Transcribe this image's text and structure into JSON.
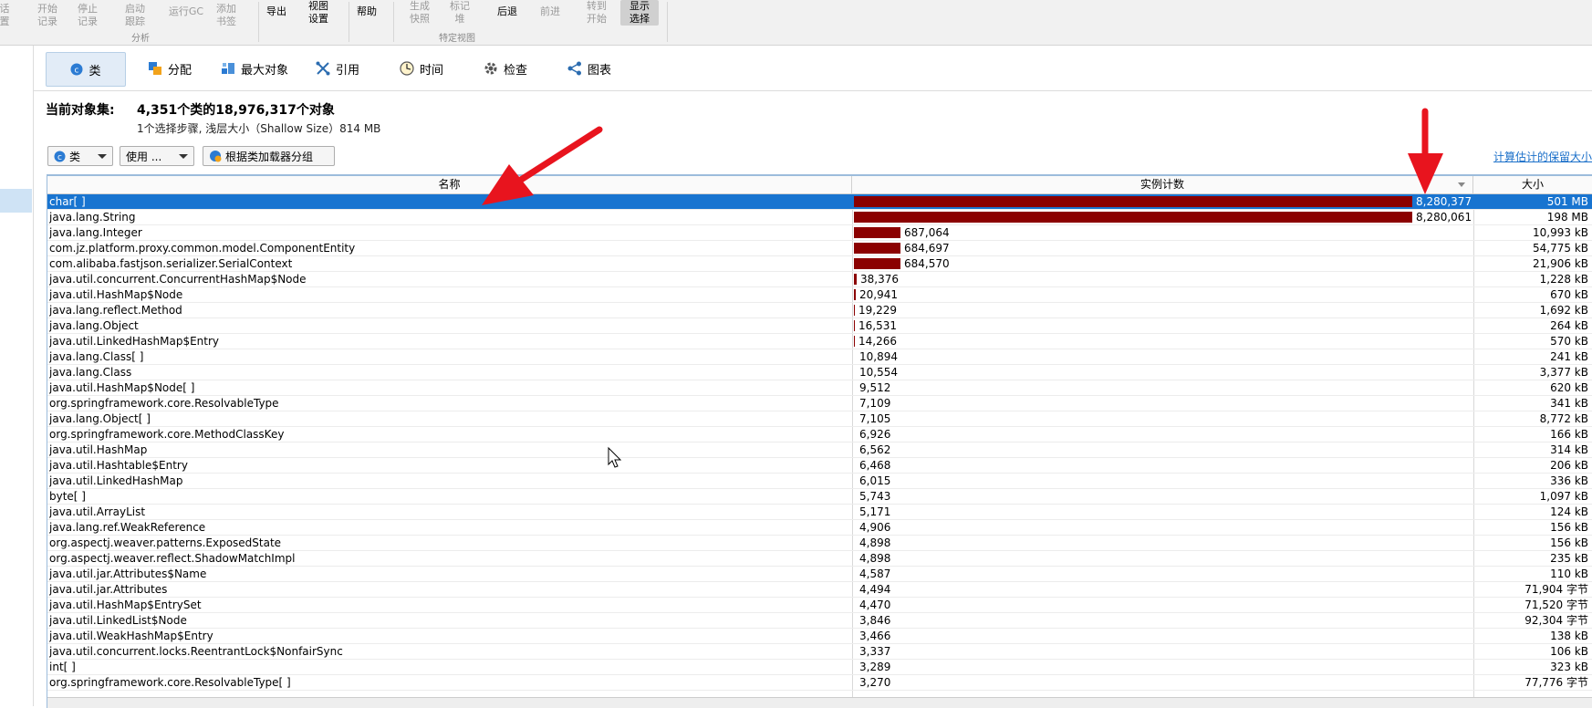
{
  "ribbon": {
    "buttons": [
      {
        "id": "settings",
        "label": "话\n置",
        "state": "dis"
      },
      {
        "id": "start-record",
        "label": "开始\n记录",
        "state": "dis"
      },
      {
        "id": "stop-record",
        "label": "停止\n记录",
        "state": "dis"
      },
      {
        "id": "start-trace",
        "label": "启动\n跟踪",
        "state": "dis"
      },
      {
        "id": "run-gc",
        "label": "运行GC",
        "state": "dis"
      },
      {
        "id": "add-bookmark",
        "label": "添加\n书签",
        "state": "dis"
      },
      {
        "id": "export",
        "label": "导出",
        "state": "en"
      },
      {
        "id": "view-settings",
        "label": "视图\n设置",
        "state": "en"
      },
      {
        "id": "help",
        "label": "帮助",
        "state": "en"
      },
      {
        "id": "gen-snapshot",
        "label": "生成\n快照",
        "state": "dis"
      },
      {
        "id": "mark-heap",
        "label": "标记\n堆",
        "state": "dis"
      },
      {
        "id": "back",
        "label": "后退",
        "state": "en"
      },
      {
        "id": "forward",
        "label": "前进",
        "state": "dis"
      },
      {
        "id": "goto-start",
        "label": "转到\n开始",
        "state": "dis"
      },
      {
        "id": "show-selection",
        "label": "显示\n选择",
        "state": "active"
      }
    ],
    "groups": {
      "analysis": "分析",
      "specific_view": "特定视图"
    }
  },
  "tabs": [
    {
      "label": "类",
      "icon": "class-icon",
      "selected": true
    },
    {
      "label": "分配",
      "icon": "allocation-icon",
      "selected": false
    },
    {
      "label": "最大对象",
      "icon": "biggest-objects-icon",
      "selected": false
    },
    {
      "label": "引用",
      "icon": "references-icon",
      "selected": false
    },
    {
      "label": "时间",
      "icon": "time-icon",
      "selected": false
    },
    {
      "label": "检查",
      "icon": "inspect-icon",
      "selected": false
    },
    {
      "label": "图表",
      "icon": "graph-icon",
      "selected": false
    }
  ],
  "summary": {
    "label": "当前对象集:",
    "value": "4,351个类的18,976,317个对象",
    "sub": "1个选择步骤, 浅层大小（Shallow Size）814 MB"
  },
  "filters": {
    "class_select": "类",
    "usage_select": "使用 ...",
    "group_by_loader": "根据类加载器分组",
    "calc_retained": "计算估计的保留大小"
  },
  "table": {
    "headers": {
      "name": "名称",
      "count": "实例计数",
      "size": "大小"
    },
    "max_count": 8280377,
    "rows": [
      {
        "name": "char[ ]",
        "count": 8280377,
        "count_text": "8,280,377",
        "size": "501 MB",
        "selected": true
      },
      {
        "name": "java.lang.String",
        "count": 8280061,
        "count_text": "8,280,061",
        "size": "198 MB"
      },
      {
        "name": "java.lang.Integer",
        "count": 687064,
        "count_text": "687,064",
        "size": "10,993 kB"
      },
      {
        "name": "com.jz.platform.proxy.common.model.ComponentEntity",
        "count": 684697,
        "count_text": "684,697",
        "size": "54,775 kB"
      },
      {
        "name": "com.alibaba.fastjson.serializer.SerialContext",
        "count": 684570,
        "count_text": "684,570",
        "size": "21,906 kB"
      },
      {
        "name": "java.util.concurrent.ConcurrentHashMap$Node",
        "count": 38376,
        "count_text": "38,376",
        "size": "1,228 kB"
      },
      {
        "name": "java.util.HashMap$Node",
        "count": 20941,
        "count_text": "20,941",
        "size": "670 kB"
      },
      {
        "name": "java.lang.reflect.Method",
        "count": 19229,
        "count_text": "19,229",
        "size": "1,692 kB"
      },
      {
        "name": "java.lang.Object",
        "count": 16531,
        "count_text": "16,531",
        "size": "264 kB"
      },
      {
        "name": "java.util.LinkedHashMap$Entry",
        "count": 14266,
        "count_text": "14,266",
        "size": "570 kB"
      },
      {
        "name": "java.lang.Class[ ]",
        "count": 10894,
        "count_text": "10,894",
        "size": "241 kB"
      },
      {
        "name": "java.lang.Class",
        "count": 10554,
        "count_text": "10,554",
        "size": "3,377 kB"
      },
      {
        "name": "java.util.HashMap$Node[ ]",
        "count": 9512,
        "count_text": "9,512",
        "size": "620 kB"
      },
      {
        "name": "org.springframework.core.ResolvableType",
        "count": 7109,
        "count_text": "7,109",
        "size": "341 kB"
      },
      {
        "name": "java.lang.Object[ ]",
        "count": 7105,
        "count_text": "7,105",
        "size": "8,772 kB"
      },
      {
        "name": "org.springframework.core.MethodClassKey",
        "count": 6926,
        "count_text": "6,926",
        "size": "166 kB"
      },
      {
        "name": "java.util.HashMap",
        "count": 6562,
        "count_text": "6,562",
        "size": "314 kB"
      },
      {
        "name": "java.util.Hashtable$Entry",
        "count": 6468,
        "count_text": "6,468",
        "size": "206 kB"
      },
      {
        "name": "java.util.LinkedHashMap",
        "count": 6015,
        "count_text": "6,015",
        "size": "336 kB"
      },
      {
        "name": "byte[ ]",
        "count": 5743,
        "count_text": "5,743",
        "size": "1,097 kB"
      },
      {
        "name": "java.util.ArrayList",
        "count": 5171,
        "count_text": "5,171",
        "size": "124 kB"
      },
      {
        "name": "java.lang.ref.WeakReference",
        "count": 4906,
        "count_text": "4,906",
        "size": "156 kB"
      },
      {
        "name": "org.aspectj.weaver.patterns.ExposedState",
        "count": 4898,
        "count_text": "4,898",
        "size": "156 kB"
      },
      {
        "name": "org.aspectj.weaver.reflect.ShadowMatchImpl",
        "count": 4898,
        "count_text": "4,898",
        "size": "235 kB"
      },
      {
        "name": "java.util.jar.Attributes$Name",
        "count": 4587,
        "count_text": "4,587",
        "size": "110 kB"
      },
      {
        "name": "java.util.jar.Attributes",
        "count": 4494,
        "count_text": "4,494",
        "size": "71,904 字节"
      },
      {
        "name": "java.util.HashMap$EntrySet",
        "count": 4470,
        "count_text": "4,470",
        "size": "71,520 字节"
      },
      {
        "name": "java.util.LinkedList$Node",
        "count": 3846,
        "count_text": "3,846",
        "size": "92,304 字节"
      },
      {
        "name": "java.util.WeakHashMap$Entry",
        "count": 3466,
        "count_text": "3,466",
        "size": "138 kB"
      },
      {
        "name": "java.util.concurrent.locks.ReentrantLock$NonfairSync",
        "count": 3337,
        "count_text": "3,337",
        "size": "106 kB"
      },
      {
        "name": "int[ ]",
        "count": 3289,
        "count_text": "3,289",
        "size": "323 kB"
      },
      {
        "name": "org.springframework.core.ResolvableType[ ]",
        "count": 3270,
        "count_text": "3,270",
        "size": "77,776 字节"
      }
    ]
  },
  "colors": {
    "bar": "#8b0000",
    "selected_row": "#1874d0",
    "arrow": "#e8141e",
    "link": "#1a6fc9"
  }
}
